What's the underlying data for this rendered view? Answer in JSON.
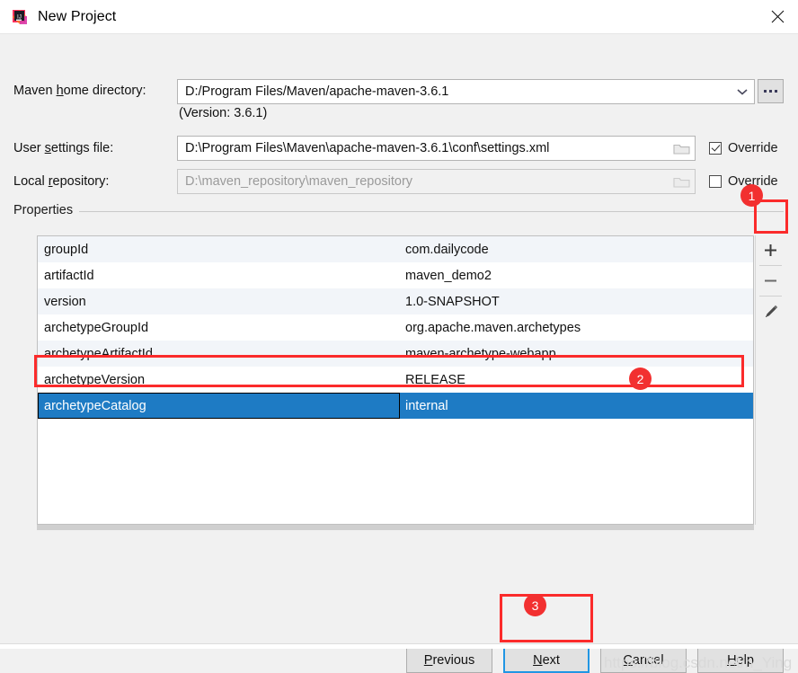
{
  "window": {
    "title": "New Project",
    "icon": "intellij-idea-icon",
    "close_icon": "close-icon"
  },
  "form": {
    "maven_home": {
      "label_before": "Maven ",
      "label_mnemonic": "h",
      "label_after": "ome directory:",
      "value": "D:/Program Files/Maven/apache-maven-3.6.1",
      "dropdown_icon": "chevron-down-icon",
      "browse_label": "..."
    },
    "version_note": "(Version: 3.6.1)",
    "user_settings": {
      "label_before": "User ",
      "label_mnemonic": "s",
      "label_after": "ettings file:",
      "value": "D:\\Program Files\\Maven\\apache-maven-3.6.1\\conf\\settings.xml",
      "folder_icon": "folder-icon",
      "override_label": "Override",
      "override_checked": true
    },
    "local_repository": {
      "label_before": "Local ",
      "label_mnemonic": "r",
      "label_after": "epository:",
      "value": "D:\\maven_repository\\maven_repository",
      "folder_icon": "folder-icon",
      "override_label": "Override",
      "override_checked": false,
      "disabled": true
    }
  },
  "properties": {
    "legend": "Properties",
    "rows": [
      {
        "key": "groupId",
        "value": "com.dailycode"
      },
      {
        "key": "artifactId",
        "value": "maven_demo2"
      },
      {
        "key": "version",
        "value": "1.0-SNAPSHOT"
      },
      {
        "key": "archetypeGroupId",
        "value": "org.apache.maven.archetypes"
      },
      {
        "key": "archetypeArtifactId",
        "value": "maven-archetype-webapp"
      },
      {
        "key": "archetypeVersion",
        "value": "RELEASE"
      },
      {
        "key": "archetypeCatalog",
        "value": "internal"
      }
    ],
    "selected_index": 6,
    "toolbar": {
      "add_icon": "plus-icon",
      "remove_icon": "minus-icon",
      "edit_icon": "pencil-icon"
    }
  },
  "footer": {
    "previous": {
      "before": "",
      "mnemonic": "P",
      "after": "revious"
    },
    "next": {
      "before": "",
      "mnemonic": "N",
      "after": "ext"
    },
    "cancel": {
      "before": "",
      "mnemonic": "C",
      "after": "ancel"
    },
    "help": {
      "before": "",
      "mnemonic": "H",
      "after": "elp"
    }
  },
  "annotations": {
    "badge1": "1",
    "badge2": "2",
    "badge3": "3"
  },
  "watermark": "https://blog.csdn.net/n_Ying",
  "colors": {
    "selection_blue": "#1e7bc4",
    "annotation_red": "#fb2b2b",
    "focus_blue": "#2196e3",
    "row_alt": "#f2f5f9"
  }
}
